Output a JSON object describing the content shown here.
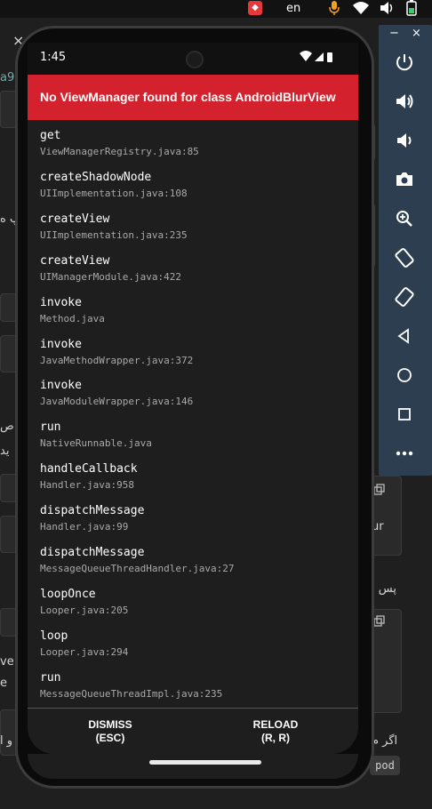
{
  "system": {
    "language": "en"
  },
  "background": {
    "tab_close": "×",
    "tab_text": "a9",
    "rtl_1": "پ ه",
    "rtl_2": "ص",
    "rtl_3": "ید",
    "frag_1": "ve",
    "frag_2": "e",
    "frag_ur": "ur",
    "rtl_pas": "پس ا",
    "rtl_agar": "اگر م",
    "rtl_o": "و ا",
    "pod": "pod"
  },
  "phone": {
    "status_time": "1:45",
    "error_title": "No ViewManager found for class AndroidBlurView",
    "stack": [
      {
        "fn": "get",
        "loc": "ViewManagerRegistry.java:85"
      },
      {
        "fn": "createShadowNode",
        "loc": "UIImplementation.java:108"
      },
      {
        "fn": "createView",
        "loc": "UIImplementation.java:235"
      },
      {
        "fn": "createView",
        "loc": "UIManagerModule.java:422"
      },
      {
        "fn": "invoke",
        "loc": "Method.java"
      },
      {
        "fn": "invoke",
        "loc": "JavaMethodWrapper.java:372"
      },
      {
        "fn": "invoke",
        "loc": "JavaModuleWrapper.java:146"
      },
      {
        "fn": "run",
        "loc": "NativeRunnable.java"
      },
      {
        "fn": "handleCallback",
        "loc": "Handler.java:958"
      },
      {
        "fn": "dispatchMessage",
        "loc": "Handler.java:99"
      },
      {
        "fn": "dispatchMessage",
        "loc": "MessageQueueThreadHandler.java:27"
      },
      {
        "fn": "loopOnce",
        "loc": "Looper.java:205"
      },
      {
        "fn": "loop",
        "loc": "Looper.java:294"
      },
      {
        "fn": "run",
        "loc": "MessageQueueThreadImpl.java:235"
      }
    ],
    "dismiss_label": "DISMISS",
    "dismiss_hint": "(ESC)",
    "reload_label": "RELOAD",
    "reload_hint": "(R, R)"
  },
  "emulator": {
    "minimize": "−",
    "close": "×",
    "buttons": [
      "power-icon",
      "volume-up-icon",
      "volume-down-icon",
      "camera-icon",
      "zoom-icon",
      "rotate-left-icon",
      "rotate-right-icon",
      "back-icon",
      "home-icon",
      "overview-icon",
      "more-icon"
    ]
  },
  "colors": {
    "error_red": "#d3222d",
    "emulator_panel": "#2c3e50"
  }
}
